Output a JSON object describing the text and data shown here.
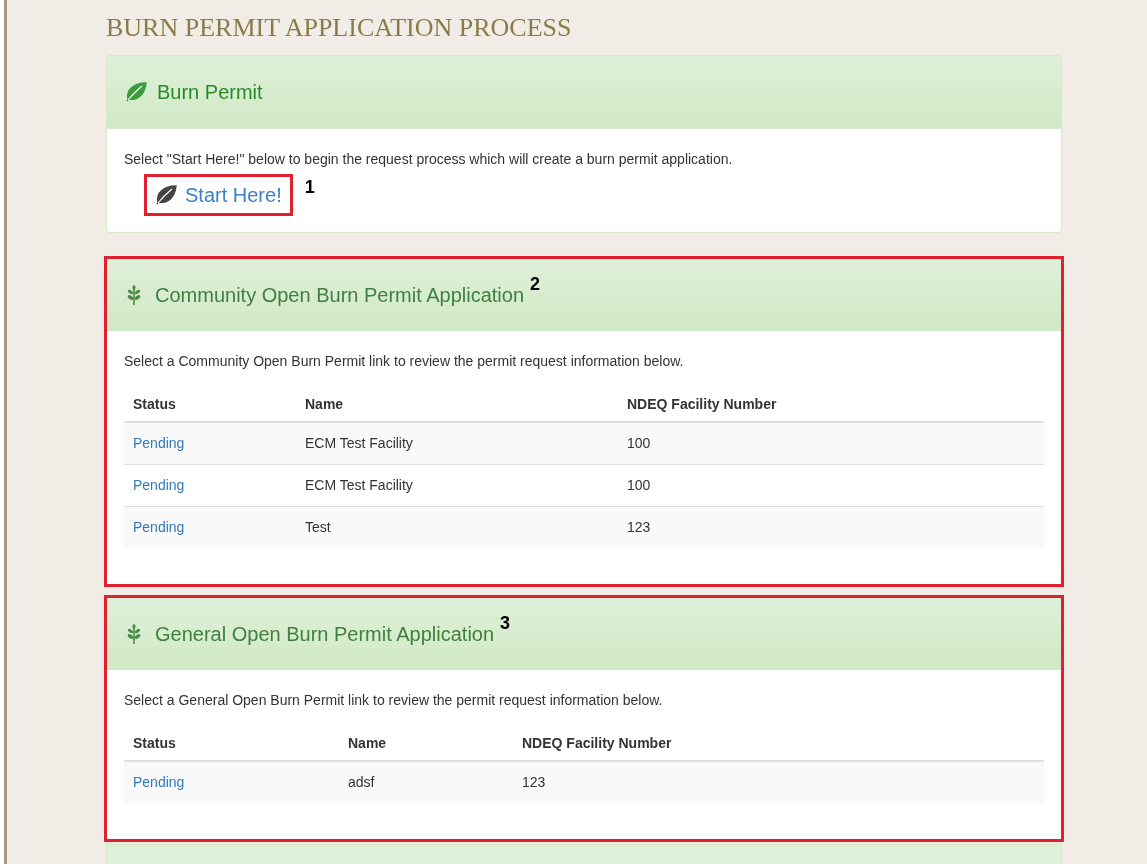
{
  "page_title": "BURN PERMIT APPLICATION PROCESS",
  "intro_panel": {
    "title": "Burn Permit",
    "text": "Select \"Start Here!\" below to begin the request process which will create a burn permit application.",
    "link": "Start Here!",
    "callout": "1"
  },
  "panels": [
    {
      "title": "Community Open Burn Permit Application",
      "callout": "2",
      "text": "Select a Community Open Burn Permit link to review the permit request information below.",
      "columns": [
        "Status",
        "Name",
        "NDEQ Facility Number"
      ],
      "rows": [
        {
          "status": "Pending",
          "name": "ECM Test Facility",
          "facility_number": "100"
        },
        {
          "status": "Pending",
          "name": "ECM Test Facility",
          "facility_number": "100"
        },
        {
          "status": "Pending",
          "name": "Test",
          "facility_number": "123"
        }
      ]
    },
    {
      "title": "General Open Burn Permit Application",
      "callout": "3",
      "text": "Select a General Open Burn Permit link to review the permit request information below.",
      "columns": [
        "Status",
        "Name",
        "NDEQ Facility Number"
      ],
      "rows": [
        {
          "status": "Pending",
          "name": "adsf",
          "facility_number": "123"
        }
      ]
    }
  ]
}
